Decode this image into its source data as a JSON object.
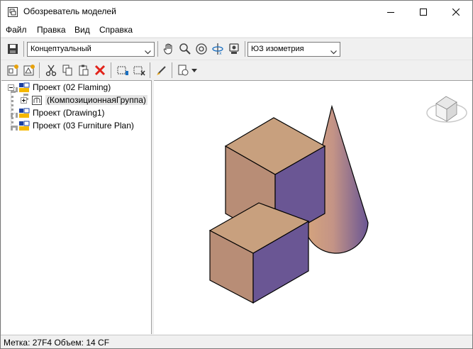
{
  "window": {
    "title": "Обозреватель моделей"
  },
  "menu": {
    "items": [
      {
        "label": "Файл"
      },
      {
        "label": "Правка"
      },
      {
        "label": "Вид"
      },
      {
        "label": "Справка"
      }
    ]
  },
  "toolbar": {
    "visual_style": "Концептуальный",
    "view": "ЮЗ изометрия"
  },
  "tree": {
    "items": [
      {
        "label": "Проект (02 Flaming)",
        "expanded": true
      },
      {
        "label": "(КомпозиционнаяГруппа)",
        "selected": true
      },
      {
        "label": "Проект (Drawing1)"
      },
      {
        "label": "Проект (03 Furniture Plan)"
      }
    ]
  },
  "status": {
    "text": "Метка: 27F4  Объем: 14 CF"
  },
  "colors": {
    "shape_top": "#c8a07e",
    "shape_left": "#b88d76",
    "shape_right": "#6a5694",
    "window_bg": "#f0f0f0"
  }
}
